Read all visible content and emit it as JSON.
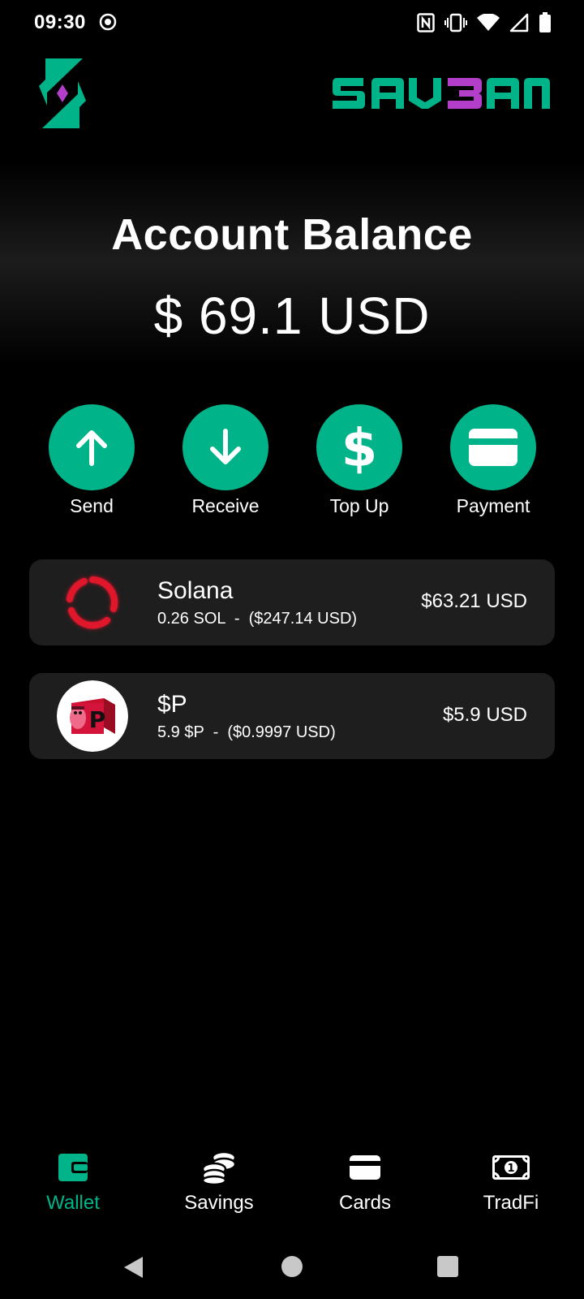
{
  "status_bar": {
    "time": "09:30",
    "icons": [
      "record-icon",
      "nfc-icon",
      "vibrate-icon",
      "wifi-icon",
      "signal-icon",
      "battery-icon"
    ]
  },
  "header": {
    "logo": "savbana-logo",
    "wordmark": "SAVBANA"
  },
  "balance": {
    "title": "Account Balance",
    "amount": "$ 69.1 USD"
  },
  "actions": [
    {
      "label": "Send",
      "icon": "arrow-up-icon"
    },
    {
      "label": "Receive",
      "icon": "arrow-down-icon"
    },
    {
      "label": "Top Up",
      "icon": "dollar-icon"
    },
    {
      "label": "Payment",
      "icon": "card-icon"
    }
  ],
  "tokens": [
    {
      "name": "Solana",
      "subtitle": "0.26 SOL  -  ($247.14 USD)",
      "value": "$63.21 USD",
      "icon": "solana-ring-icon"
    },
    {
      "name": "$P",
      "subtitle": "5.9 $P  -  ($0.9997 USD)",
      "value": "$5.9 USD",
      "icon": "p-token-icon"
    }
  ],
  "bottom_nav": {
    "active": "Wallet",
    "items": [
      {
        "label": "Wallet",
        "icon": "wallet-icon"
      },
      {
        "label": "Savings",
        "icon": "coins-icon"
      },
      {
        "label": "Cards",
        "icon": "card-icon"
      },
      {
        "label": "TradFi",
        "icon": "banknote-icon"
      }
    ]
  },
  "colors": {
    "accent": "#00b389",
    "background": "#000000",
    "card": "#1e1e1e",
    "wordmark_highlight": "#b23ec9"
  }
}
